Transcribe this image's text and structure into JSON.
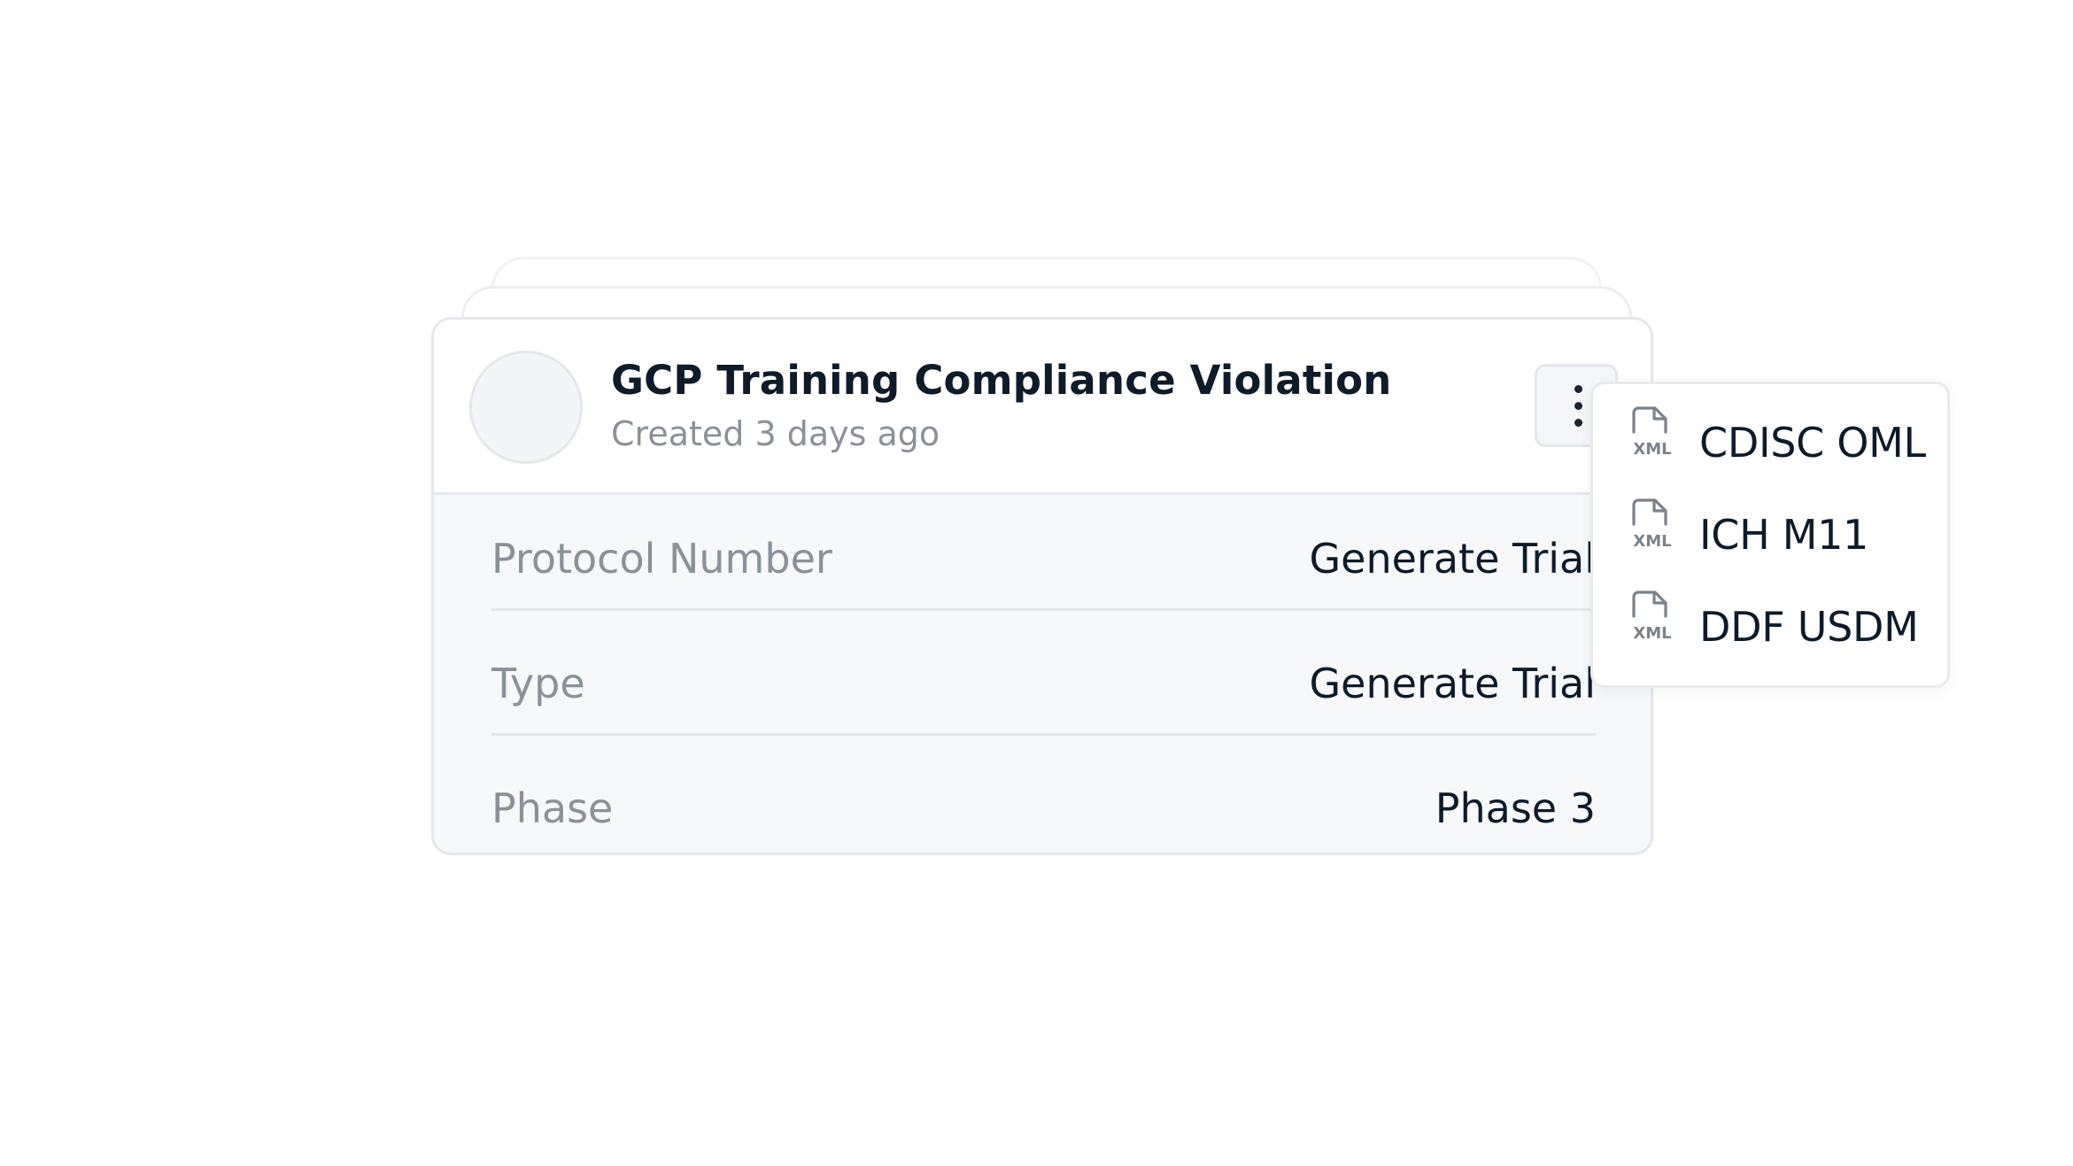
{
  "card": {
    "title": "GCP Training Compliance Violation",
    "subtitle": "Created 3 days ago",
    "rows": [
      {
        "label": "Protocol Number",
        "value": "Generate Trial"
      },
      {
        "label": "Type",
        "value": "Generate Trial"
      },
      {
        "label": "Phase",
        "value": "Phase 3"
      }
    ]
  },
  "menu": {
    "items": [
      {
        "icon": "xml-file-icon",
        "label": "CDISC OML"
      },
      {
        "icon": "xml-file-icon",
        "label": "ICH M11"
      },
      {
        "icon": "xml-file-icon",
        "label": "DDF USDM"
      }
    ],
    "icon_text": "XML"
  },
  "colors": {
    "text_primary": "#0d1b2a",
    "text_muted": "#8a9199",
    "border": "#e4e7eb",
    "panel_bg": "#f7f8fa",
    "icon_gray": "#7a828b"
  }
}
